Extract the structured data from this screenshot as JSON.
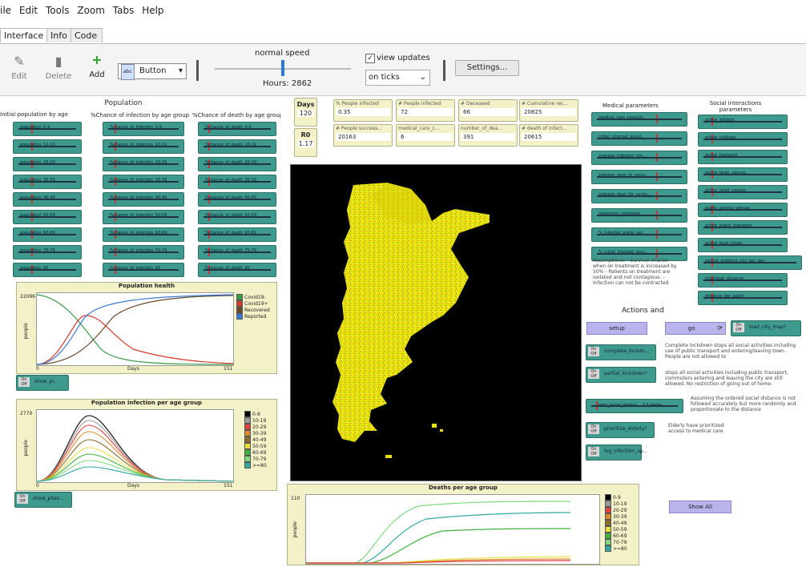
{
  "menu": [
    "ile",
    "Edit",
    "Tools",
    "Zoom",
    "Tabs",
    "Help"
  ],
  "tabs": [
    "Interface",
    "Info",
    "Code"
  ],
  "toolbar": {
    "edit": "Edit",
    "delete": "Delete",
    "add": "Add",
    "widget_type": "Button",
    "speed_label": "normal speed",
    "hours": "Hours: 2862",
    "view_updates": "view updates",
    "update_mode": "on ticks",
    "settings": "Settings..."
  },
  "headers": {
    "population": "Population",
    "initial_pop": "Initial population by age group",
    "chance_infection": "%Chance of infection by age group",
    "chance_death": "%Chance of death by age group",
    "medical": "Medical parameters",
    "social": "Social interactions parameters",
    "actions": "Actions and"
  },
  "counters": {
    "days_label": "Days",
    "days_value": "120",
    "r0_label": "R0",
    "r0_value": "1.17"
  },
  "monitors": [
    {
      "label": "% People infected",
      "value": "0.35"
    },
    {
      "label": "# People infected",
      "value": "72"
    },
    {
      "label": "# Deceased",
      "value": "66"
    },
    {
      "label": "# Cumulative rec...",
      "value": "20825"
    },
    {
      "label": "# People success...",
      "value": "20163"
    },
    {
      "label": "medical_care_c...",
      "value": "6"
    },
    {
      "label": "number_of_dea...",
      "value": "391"
    },
    {
      "label": "# death of infect...",
      "value": "20615"
    }
  ],
  "sliders_left": [
    "population_0-9",
    "population_10-19",
    "population_20-29",
    "population_30-39",
    "population_40-49",
    "population_50-59",
    "population_60-69",
    "population_70-79",
    "population_80"
  ],
  "sliders_mid": [
    "%chance_of_infection_0-9",
    "%chance_of_infection_10-19",
    "%chance_of_infection_20-29",
    "%chance_of_infection_30-39",
    "%chance_of_infection_40-49",
    "%chance_of_infection_50-59",
    "%chance_of_infection_60-69",
    "%chance_of_infection_70-79",
    "%chance_of_infection_80"
  ],
  "sliders_right": [
    "%chance_of_death_0-9",
    "%chance_of_death_10-19",
    "%chance_of_death_20-29",
    "%chance_of_death_30-39",
    "%chance_of_death_40-49",
    "%chance_of_death_50-59",
    "%chance_of_death_60-69",
    "%chance_of_death_70-79",
    "%chance_of_death_80"
  ],
  "sliders_medical": [
    "medical_care_capacity",
    "initial_infected_popul...",
    "average_infection_tim...",
    "average_days_to_recov...",
    "average_days_for_conta...",
    "maximum_contagion",
    "%_infected_prefer_sel...",
    "%_initial_infected_reco..."
  ],
  "sliders_social": [
    "active_schools",
    "active_colleges",
    "active_transport",
    "active_large_venues",
    "active_retail_venues",
    "public_service_venues",
    "active_public_transport",
    "active_local_shops",
    "people_entering_city_per_day",
    "individual_distance",
    "distance_per_patch"
  ],
  "assumptions": "Assumptions: - Survival chance when on treatment is increased by 50% - Patients on treatment are isolated and not contagious. - Infection can not be contracted",
  "actions": {
    "setup": "setup",
    "go": "go",
    "load_map": "load_city_map?",
    "complete_lockdown": "complete_lockdo...",
    "complete_desc": "Complete lockdown stops all social activities including use of public transport and entering/leaving town. People are not allowed to",
    "partial_lockdown": "partial_lockdown?",
    "partial_desc": "stops all social activities including public transport, commuters entering and leaving the city are still allowed. No restriction of going out of home.",
    "keep_distance": "keep_social_distanc... 0.5 meter",
    "keep_desc": "Assuming the ordered social distance is not followed accurately but more randomly and proportionate to the distance",
    "prioritize": "prioritize_elderly?",
    "prioritize_desc": "Elderly have prioritized access to medical care",
    "log": "log_infection_sp...",
    "show_all": "Show All"
  },
  "health_plot": {
    "title": "Population health",
    "ylabel": "people",
    "xlabel": "Days",
    "ymax": "22096",
    "xmin": "0",
    "xmax": "151",
    "legend": [
      {
        "name": "Covid19-",
        "color": "#3a9a4a"
      },
      {
        "name": "Covid19+",
        "color": "#d43a2a"
      },
      {
        "name": "Recovered",
        "color": "#6b4a2a"
      },
      {
        "name": "Reported",
        "color": "#3a7ad4"
      }
    ],
    "show_btn": "show_pl..."
  },
  "infection_plot": {
    "title": "Population infection per age group",
    "ylabel": "people",
    "xlabel": "Days",
    "ymax": "2770",
    "xmin": "0",
    "xmax": "151",
    "legend": [
      {
        "name": "0-9",
        "color": "#000000"
      },
      {
        "name": "10-19",
        "color": "#9a9a9a"
      },
      {
        "name": "20-29",
        "color": "#e04040"
      },
      {
        "name": "30-39",
        "color": "#e08a30"
      },
      {
        "name": "40-49",
        "color": "#8a6a30"
      },
      {
        "name": "50-59",
        "color": "#e8e040"
      },
      {
        "name": "60-69",
        "color": "#40b040"
      },
      {
        "name": "70-79",
        "color": "#80d880"
      },
      {
        "name": ">=80",
        "color": "#30a8a0"
      }
    ],
    "show_btn": "show_phas..."
  },
  "deaths_plot": {
    "title": "Deaths per age group",
    "ylabel": "people",
    "ymax": "110",
    "ymin": "0",
    "legend": [
      {
        "name": "0-9",
        "color": "#000000"
      },
      {
        "name": "10-19",
        "color": "#9a9a9a"
      },
      {
        "name": "20-29",
        "color": "#e04040"
      },
      {
        "name": "30-39",
        "color": "#e08a30"
      },
      {
        "name": "40-49",
        "color": "#8a6a30"
      },
      {
        "name": "50-59",
        "color": "#e8e040"
      },
      {
        "name": "60-69",
        "color": "#40b040"
      },
      {
        "name": "70-79",
        "color": "#80d880"
      },
      {
        "name": ">=80",
        "color": "#30a8a0"
      }
    ]
  }
}
